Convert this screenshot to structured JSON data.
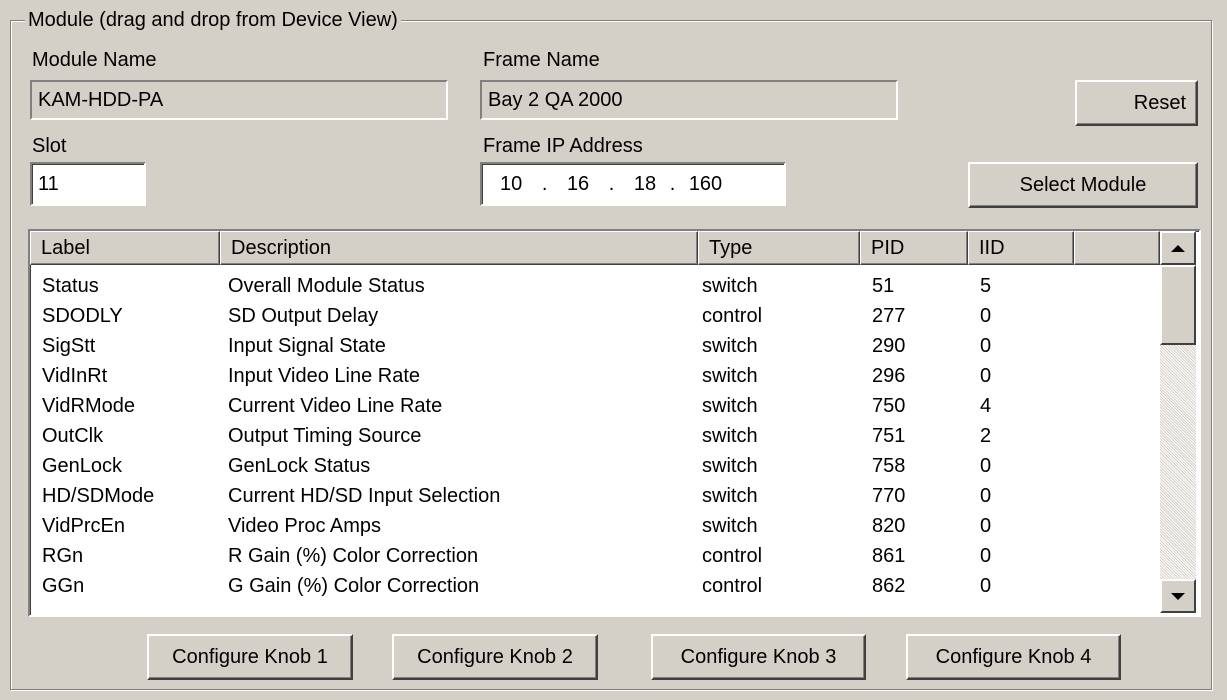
{
  "group": {
    "title": "Module (drag and drop from Device View)"
  },
  "module_name": {
    "label": "Module Name",
    "value": "KAM-HDD-PA"
  },
  "frame_name": {
    "label": "Frame Name",
    "value": "Bay 2 QA 2000"
  },
  "slot": {
    "label": "Slot",
    "value": "11"
  },
  "frame_ip": {
    "label": "Frame IP Address",
    "octets": [
      "10",
      "16",
      "18",
      "160"
    ]
  },
  "buttons": {
    "reset": "Reset",
    "select_module": "Select Module",
    "knob1": "Configure Knob 1",
    "knob2": "Configure Knob 2",
    "knob3": "Configure Knob 3",
    "knob4": "Configure Knob 4"
  },
  "table": {
    "columns": [
      "Label",
      "Description",
      "Type",
      "PID",
      "IID"
    ],
    "rows": [
      {
        "label": "Status",
        "description": "Overall Module Status",
        "type": "switch",
        "pid": "51",
        "iid": "5"
      },
      {
        "label": "SDODLY",
        "description": "SD Output Delay",
        "type": "control",
        "pid": "277",
        "iid": "0"
      },
      {
        "label": "SigStt",
        "description": "Input Signal State",
        "type": "switch",
        "pid": "290",
        "iid": "0"
      },
      {
        "label": "VidInRt",
        "description": "Input Video Line Rate",
        "type": "switch",
        "pid": "296",
        "iid": "0"
      },
      {
        "label": "VidRMode",
        "description": "Current Video Line Rate",
        "type": "switch",
        "pid": "750",
        "iid": "4"
      },
      {
        "label": "OutClk",
        "description": "Output Timing Source",
        "type": "switch",
        "pid": "751",
        "iid": "2"
      },
      {
        "label": "GenLock",
        "description": "GenLock Status",
        "type": "switch",
        "pid": "758",
        "iid": "0"
      },
      {
        "label": "HD/SDMode",
        "description": "Current HD/SD Input Selection",
        "type": "switch",
        "pid": "770",
        "iid": "0"
      },
      {
        "label": "VidPrcEn",
        "description": "Video Proc Amps",
        "type": "switch",
        "pid": "820",
        "iid": "0"
      },
      {
        "label": "RGn",
        "description": "R Gain (%) Color Correction",
        "type": "control",
        "pid": "861",
        "iid": "0"
      },
      {
        "label": "GGn",
        "description": "G Gain (%) Color Correction",
        "type": "control",
        "pid": "862",
        "iid": "0"
      }
    ]
  },
  "scrollbar": {
    "up_icon": "arrow-up-icon",
    "down_icon": "arrow-down-icon"
  }
}
